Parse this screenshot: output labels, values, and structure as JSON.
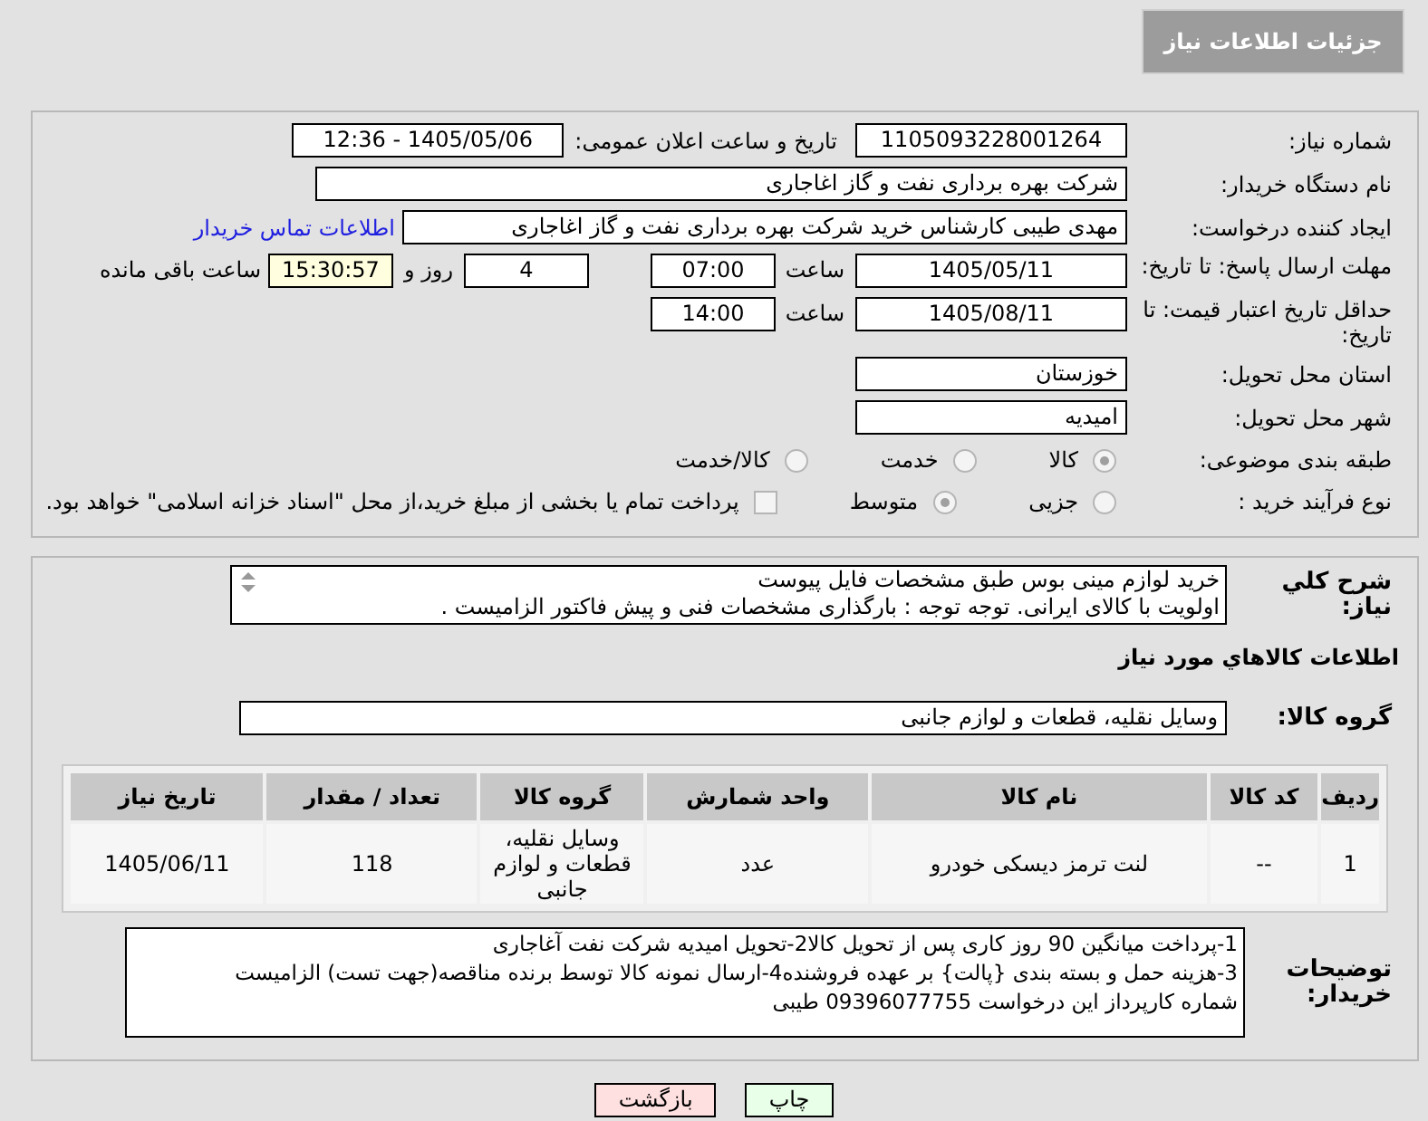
{
  "header": {
    "title": "جزئیات اطلاعات نیاز"
  },
  "need_number": {
    "label": "شماره نیاز:",
    "value": "1105093228001264"
  },
  "announce": {
    "label": "تاریخ و ساعت اعلان عمومی:",
    "value": "1405/05/06 - 12:36"
  },
  "buyer_org": {
    "label": "نام دستگاه خریدار:",
    "value": "شرکت بهره برداری نفت و گاز اغاجاری"
  },
  "requester": {
    "label": "ایجاد کننده درخواست:",
    "value": "مهدی طیبی کارشناس خرید شرکت بهره برداری نفت و گاز اغاجاری",
    "link": "اطلاعات تماس خریدار"
  },
  "reply_deadline": {
    "label": "مهلت ارسال پاسخ: تا تاریخ:",
    "date": "1405/05/11",
    "time_label": "ساعت",
    "time": "07:00",
    "days": "4",
    "days_label": "روز و",
    "remaining": "15:30:57",
    "remaining_label": "ساعت باقی مانده"
  },
  "price_validity": {
    "label": "حداقل تاریخ اعتبار قیمت: تا تاریخ:",
    "date": "1405/08/11",
    "time_label": "ساعت",
    "time": "14:00"
  },
  "province": {
    "label": "استان محل تحویل:",
    "value": "خوزستان"
  },
  "city": {
    "label": "شهر محل تحویل:",
    "value": "امیدیه"
  },
  "category": {
    "label": "طبقه بندی موضوعی:",
    "options": [
      {
        "label": "کالا",
        "selected": true
      },
      {
        "label": "خدمت",
        "selected": false
      },
      {
        "label": "کالا/خدمت",
        "selected": false
      }
    ]
  },
  "process": {
    "label": "نوع فرآیند خرید :",
    "options": [
      {
        "label": "جزیی",
        "selected": false
      },
      {
        "label": "متوسط",
        "selected": true
      }
    ],
    "payment": {
      "label": "پرداخت تمام یا بخشی از مبلغ خرید،از محل \"اسناد خزانه اسلامی\" خواهد بود.",
      "checked": false
    }
  },
  "description": {
    "label": "شرح کلي نیاز:",
    "lines": [
      "خرید لوازم مینی بوس طبق مشخصات فایل پیوست",
      "اولویت با کالای ایرانی. توجه توجه : بارگذاری مشخصات فنی و پیش فاکتور الزامیست ."
    ]
  },
  "goods_heading": "اطلاعات کالاهاي مورد نیاز",
  "goods_group": {
    "label": "گروه کالا:",
    "value": "وسایل نقلیه، قطعات و لوازم جانبی"
  },
  "table": {
    "columns": [
      "ردیف",
      "کد کالا",
      "نام کالا",
      "واحد شمارش",
      "گروه کالا",
      "تعداد / مقدار",
      "تاریخ نیاز"
    ],
    "rows": [
      [
        "1",
        "--",
        "لنت ترمز دیسکی خودرو",
        "عدد",
        "وسایل نقلیه، قطعات و لوازم جانبی",
        "118",
        "1405/06/11"
      ]
    ]
  },
  "buyer_notes": {
    "label": "توضیحات خریدار:",
    "lines": [
      "1-پرداخت میانگین 90 روز کاری پس از تحویل کالا2-تحویل امیدیه شرکت نفت آغاجاری",
      "3-هزینه حمل  و بسته بندی {پالت} بر عهده فروشنده4-ارسال نمونه کالا توسط برنده مناقصه(جهت تست) الزامیست",
      "شماره کارپرداز این درخواست 09396077755 طیبی"
    ]
  },
  "buttons": [
    {
      "kind": "print",
      "label": "چاپ"
    },
    {
      "kind": "back",
      "label": "بازگشت"
    }
  ]
}
